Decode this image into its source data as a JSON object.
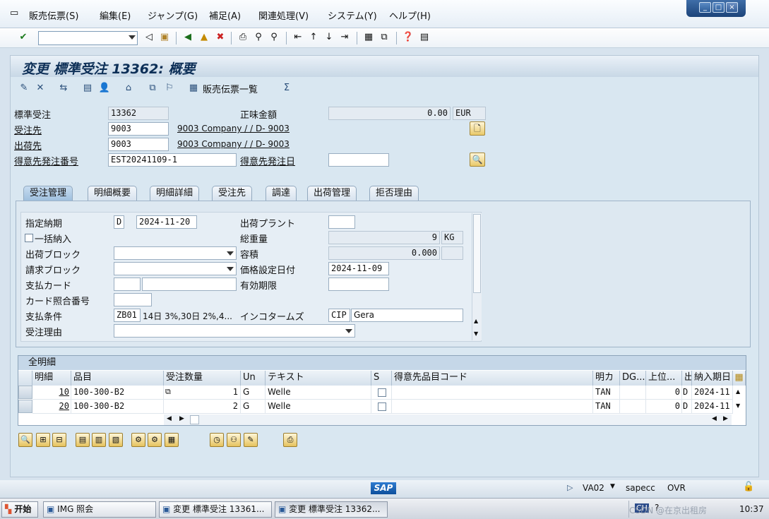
{
  "menubar": {
    "items": [
      "販売伝票(S)",
      "編集(E)",
      "ジャンプ(G)",
      "補足(A)",
      "関連処理(V)",
      "システム(Y)",
      "ヘルプ(H)"
    ]
  },
  "window_controls": {
    "minimize": "_",
    "restore": "□",
    "close": "×"
  },
  "title": "変更 標準受注 13362: 概要",
  "app_toolbar": {
    "sales_docs_list": "販売伝票一覧"
  },
  "header": {
    "order_label": "標準受注",
    "order_value": "13362",
    "net_value_label": "正味金額",
    "net_value": "0.00",
    "currency": "EUR",
    "sold_to_label": "受注先",
    "sold_to_value": "9003",
    "sold_to_name": "9003 Company / / D- 9003",
    "ship_to_label": "出荷先",
    "ship_to_value": "9003",
    "ship_to_name": "9003 Company / / D- 9003",
    "po_label": "得意先発注番号",
    "po_value": "EST20241109-1",
    "po_date_label": "得意先発注日",
    "po_date_value": ""
  },
  "tabs": [
    "受注管理",
    "明細概要",
    "明細詳細",
    "受注先",
    "調達",
    "出荷管理",
    "拒否理由"
  ],
  "sales_tab": {
    "req_deliv_date_label": "指定納期",
    "req_deliv_date_type": "D",
    "req_deliv_date": "2024-11-20",
    "deliv_plant_label": "出荷プラント",
    "deliv_plant": "",
    "complete_dlv_label": "一括納入",
    "total_weight_label": "総重量",
    "total_weight": "9",
    "weight_unit": "KG",
    "delivery_block_label": "出荷ブロック",
    "volume_label": "容積",
    "volume": "0.000",
    "billing_block_label": "請求ブロック",
    "pricing_date_label": "価格設定日付",
    "pricing_date": "2024-11-09",
    "payment_card_label": "支払カード",
    "valid_to_label": "有効期限",
    "card_verif_label": "カード照合番号",
    "payment_terms_label": "支払条件",
    "payment_terms": "ZB01",
    "payment_terms_text": "14日 3%,30日 2%,4...",
    "incoterms_label": "インコタームズ",
    "incoterms": "CIP",
    "incoterms_place": "Gera",
    "order_reason_label": "受注理由"
  },
  "items_grid": {
    "title": "全明細",
    "columns": [
      "明細",
      "品目",
      "受注数量",
      "Un",
      "テキスト",
      "S",
      "得意先品目コード",
      "明カ",
      "DG...",
      "上位...",
      "出",
      "納入期日"
    ],
    "rows": [
      {
        "item": "10",
        "material": "100-300-B2",
        "qty": "1",
        "unit": "G",
        "text": "Welle",
        "cat": "TAN",
        "hl": "0",
        "d": "D",
        "date": "2024-11"
      },
      {
        "item": "20",
        "material": "100-300-B2",
        "qty": "2",
        "unit": "G",
        "text": "Welle",
        "cat": "TAN",
        "hl": "0",
        "d": "D",
        "date": "2024-11"
      }
    ]
  },
  "statusbar": {
    "logo": "SAP",
    "tcode": "VA02",
    "server": "sapecc",
    "mode": "OVR"
  },
  "taskbar": {
    "start": "开始",
    "tasks": [
      "IMG 照会",
      "変更 標準受注 13361...",
      "変更 標準受注 13362..."
    ],
    "tray_text": "CSDN @在京出租房",
    "clock": "10:37"
  },
  "colors": {
    "title_text": "#0d2f57",
    "main_bg": "#d9e7f1"
  }
}
